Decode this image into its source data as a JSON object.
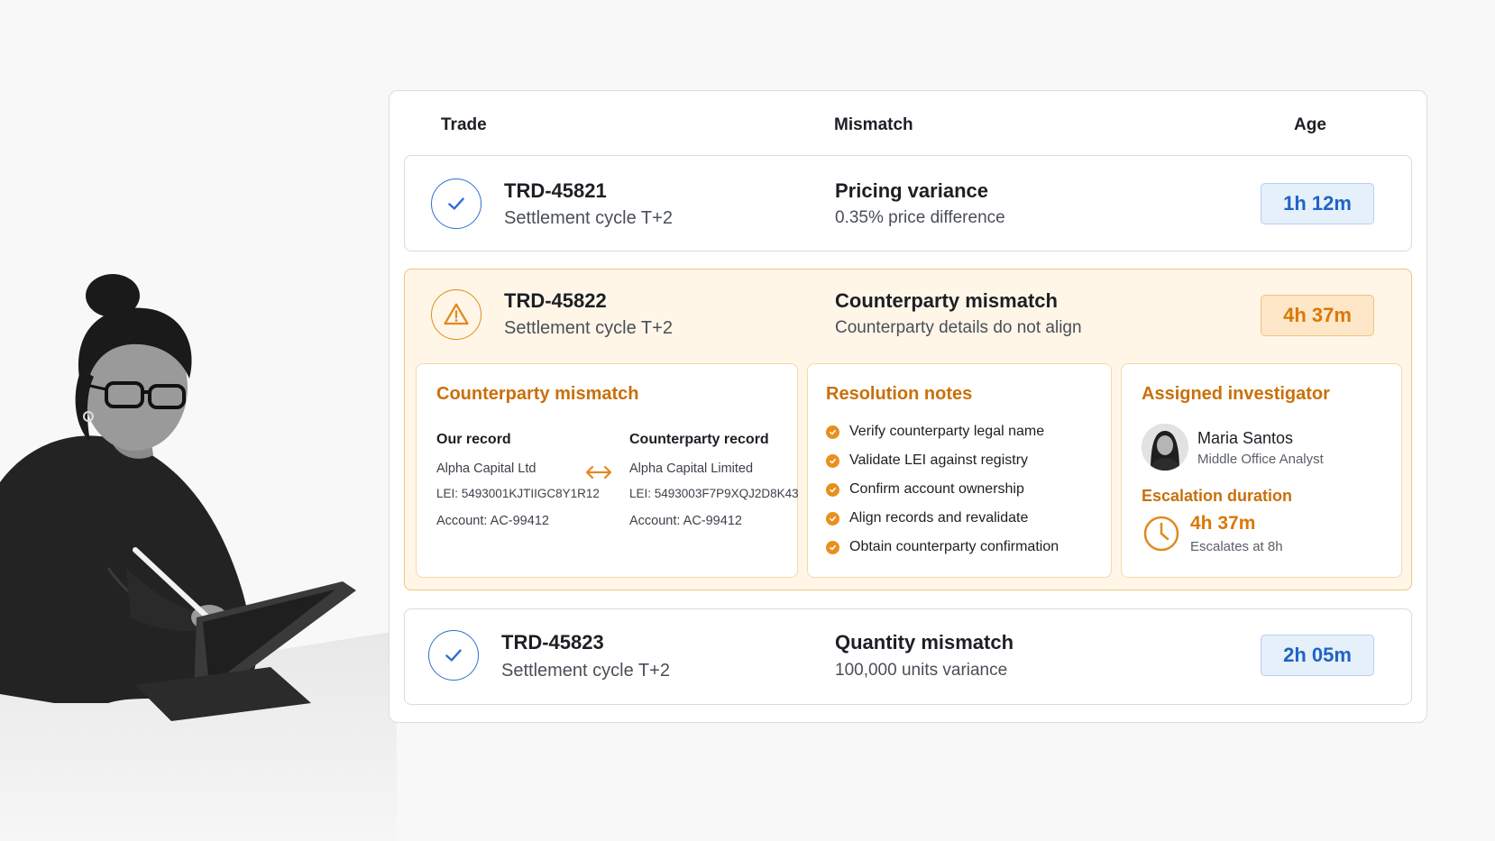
{
  "table": {
    "headers": {
      "trade": "Trade",
      "mismatch": "Mismatch",
      "age": "Age"
    },
    "rows": [
      {
        "status": "check-icon",
        "id": "TRD-45821",
        "cycle": "Settlement cycle T+2",
        "mismatch": "Pricing variance",
        "detail": "0.35% price difference",
        "age": "1h 12m"
      },
      {
        "status": "warning-icon",
        "id": "TRD-45822",
        "cycle": "Settlement cycle T+2",
        "mismatch": "Counterparty mismatch",
        "detail": "Counterparty details do not align",
        "age": "4h 37m"
      },
      {
        "status": "check-icon",
        "id": "TRD-45823",
        "cycle": "Settlement cycle T+2",
        "mismatch": "Quantity mismatch",
        "detail": "100,000 units variance",
        "age": "2h 05m"
      }
    ]
  },
  "expanded": {
    "comparison": {
      "title": "Counterparty mismatch",
      "ours": {
        "heading": "Our record",
        "name": "Alpha Capital Ltd",
        "lei": "LEI: 5493001KJTIIGC8Y1R12",
        "account": "Account: AC-99412"
      },
      "theirs": {
        "heading": "Counterparty record",
        "name": "Alpha Capital Limited",
        "lei": "LEI: 5493003F7P9XQJ2D8K43",
        "account": "Account: AC-99412"
      },
      "arrow_icon": "double-arrow-icon"
    },
    "notes": {
      "title": "Resolution notes",
      "items": [
        "Verify counterparty legal name",
        "Validate LEI against registry",
        "Confirm account ownership",
        "Align records and revalidate",
        "Obtain counterparty confirmation"
      ]
    },
    "investigator": {
      "title": "Assigned investigator",
      "name": "Maria Santos",
      "role": "Middle Office Analyst",
      "escalation_label": "Escalation duration",
      "duration": "4h 37m",
      "escalates": "Escalates at 8h"
    }
  },
  "colors": {
    "accent_blue": "#1f63c4",
    "accent_orange": "#d97806",
    "warning_bg": "#fff6e8"
  }
}
